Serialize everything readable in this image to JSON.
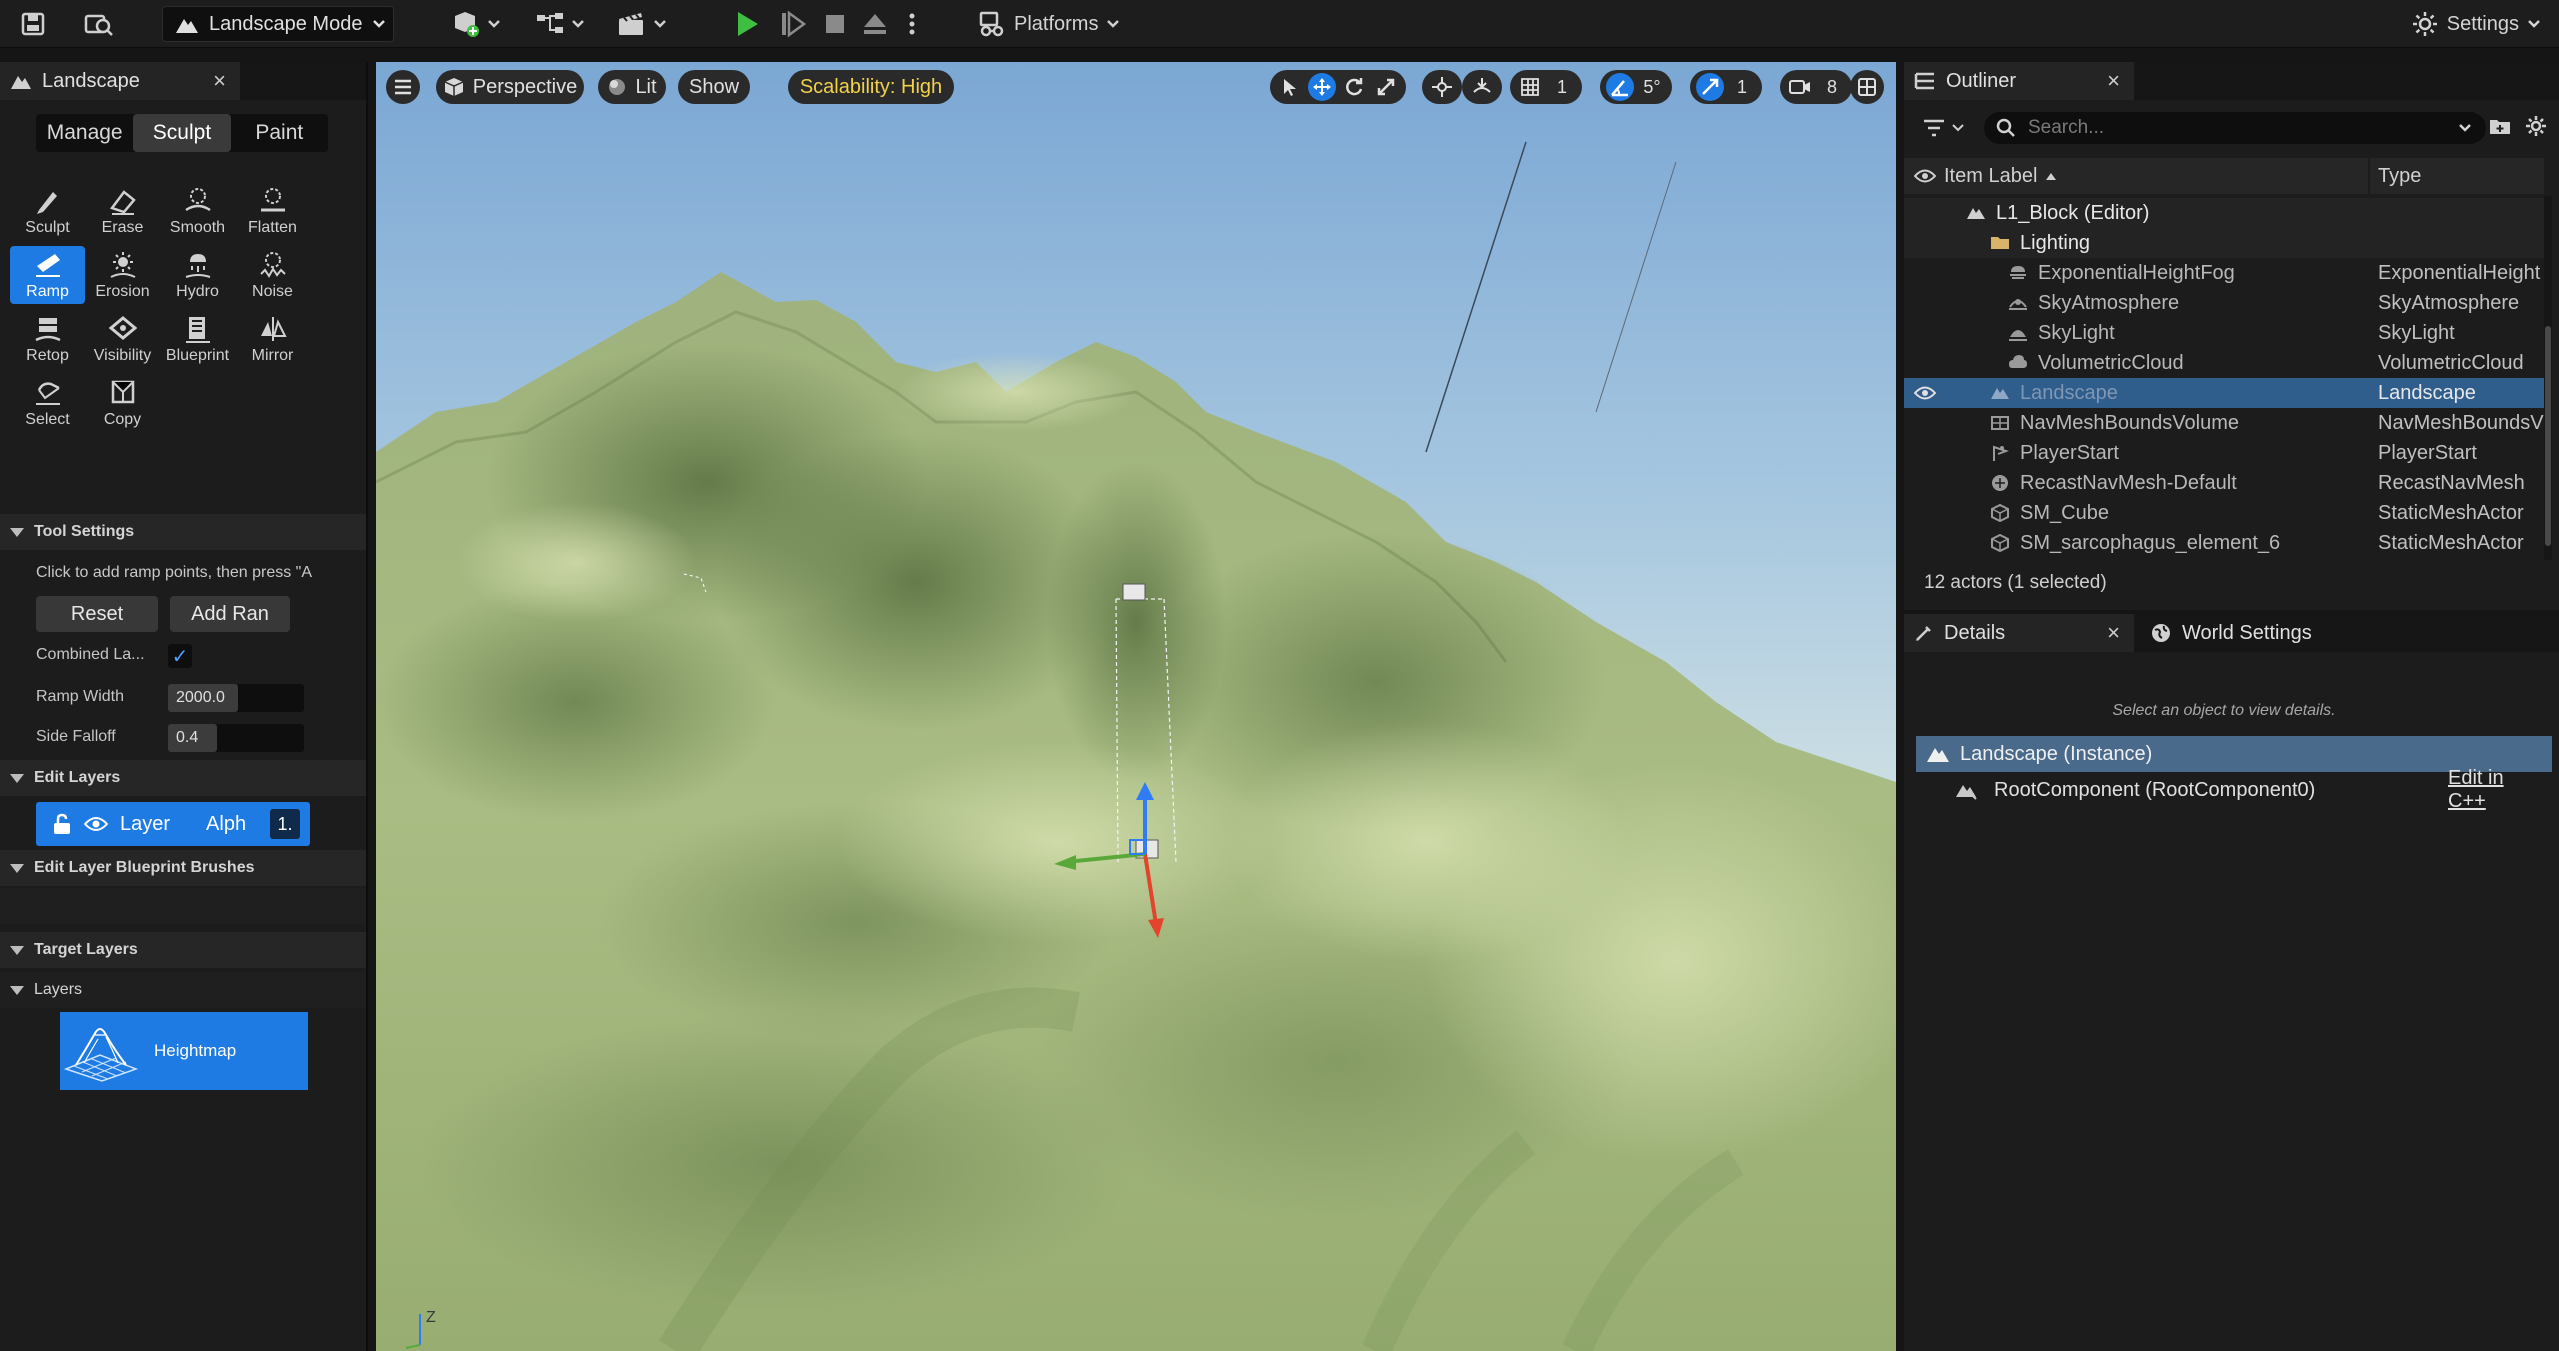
{
  "toolbar": {
    "mode_label": "Landscape Mode",
    "platforms_label": "Platforms",
    "settings_label": "Settings",
    "icons": [
      "save-icon",
      "content-browser-icon",
      "add-actor-icon",
      "blueprint-icon",
      "cinematics-icon",
      "play-icon",
      "step-icon",
      "stop-icon",
      "eject-icon",
      "more-icon",
      "platforms-icon",
      "settings-icon"
    ],
    "play_color": "#3fbf3f"
  },
  "landscape_panel": {
    "tab_title": "Landscape",
    "close_glyph": "×",
    "mode_tabs": [
      "Manage",
      "Sculpt",
      "Paint"
    ],
    "active_mode_tab": "Sculpt",
    "tools": [
      {
        "label": "Sculpt",
        "icon": "sculpt-icon"
      },
      {
        "label": "Erase",
        "icon": "erase-icon"
      },
      {
        "label": "Smooth",
        "icon": "smooth-icon"
      },
      {
        "label": "Flatten",
        "icon": "flatten-icon"
      },
      {
        "label": "Ramp",
        "icon": "ramp-icon"
      },
      {
        "label": "Erosion",
        "icon": "erosion-icon"
      },
      {
        "label": "Hydro",
        "icon": "hydro-icon"
      },
      {
        "label": "Noise",
        "icon": "noise-icon"
      },
      {
        "label": "Retop",
        "icon": "retop-icon"
      },
      {
        "label": "Visibility",
        "icon": "visibility-icon"
      },
      {
        "label": "Blueprint",
        "icon": "blueprint-icon"
      },
      {
        "label": "Mirror",
        "icon": "mirror-icon"
      },
      {
        "label": "Select",
        "icon": "select-icon"
      },
      {
        "label": "Copy",
        "icon": "copy-icon"
      }
    ],
    "active_tool": "Ramp",
    "tool_settings": {
      "header": "Tool Settings",
      "hint": "Click to add ramp points, then press \"A",
      "reset_label": "Reset",
      "add_ramp_label": "Add Ran",
      "combined_label": "Combined La...",
      "combined_checked": true,
      "ramp_width_label": "Ramp Width",
      "ramp_width_value": "2000.0",
      "side_falloff_label": "Side Falloff",
      "side_falloff_value": "0.4",
      "side_falloff_fraction": 0.4
    },
    "edit_layers": {
      "header": "Edit Layers",
      "layer_name": "Layer",
      "alpha_label": "Alph",
      "alpha_value": "1."
    },
    "blueprint_brushes_header": "Edit Layer Blueprint Brushes",
    "target_layers_header": "Target Layers",
    "layers_header": "Layers",
    "heightmap_label": "Heightmap"
  },
  "viewport": {
    "perspective_label": "Perspective",
    "lit_label": "Lit",
    "show_label": "Show",
    "scalability_label": "Scalability: High",
    "scalability_color": "#f2d24a",
    "grid_snap_value": "1",
    "angle_snap_value": "5°",
    "scale_snap_value": "1",
    "camera_speed_value": "8",
    "axis_label": "Z"
  },
  "outliner": {
    "tab_title": "Outliner",
    "close_glyph": "×",
    "search_placeholder": "Search...",
    "col_label": "Item Label",
    "col_type": "Type",
    "rows": [
      {
        "label": "L1_Block (Editor)",
        "type": "",
        "indent": 1,
        "icon": "map-icon"
      },
      {
        "label": "Lighting",
        "type": "",
        "indent": 2,
        "icon": "folder-icon"
      },
      {
        "label": "ExponentialHeightFog",
        "type": "ExponentialHeight",
        "indent": 3,
        "icon": "fog-icon"
      },
      {
        "label": "SkyAtmosphere",
        "type": "SkyAtmosphere",
        "indent": 3,
        "icon": "sky-atmosphere-icon"
      },
      {
        "label": "SkyLight",
        "type": "SkyLight",
        "indent": 3,
        "icon": "skylight-icon"
      },
      {
        "label": "VolumetricCloud",
        "type": "VolumetricCloud",
        "indent": 3,
        "icon": "cloud-icon"
      },
      {
        "label": "Landscape",
        "type": "Landscape",
        "indent": 2,
        "icon": "landscape-icon",
        "selected": true
      },
      {
        "label": "NavMeshBoundsVolume",
        "type": "NavMeshBoundsV",
        "indent": 2,
        "icon": "navmesh-icon"
      },
      {
        "label": "PlayerStart",
        "type": "PlayerStart",
        "indent": 2,
        "icon": "player-start-icon"
      },
      {
        "label": "RecastNavMesh-Default",
        "type": "RecastNavMesh",
        "indent": 2,
        "icon": "recast-icon"
      },
      {
        "label": "SM_Cube",
        "type": "StaticMeshActor",
        "indent": 2,
        "icon": "static-mesh-icon"
      },
      {
        "label": "SM_sarcophagus_element_6",
        "type": "StaticMeshActor",
        "indent": 2,
        "icon": "static-mesh-icon"
      }
    ],
    "status": "12 actors (1 selected)"
  },
  "details": {
    "tab_title": "Details",
    "close_glyph": "×",
    "world_settings_label": "World Settings",
    "message": "Select an object to view details.",
    "instance_label": "Landscape (Instance)",
    "root_label": "RootComponent (RootComponent0)",
    "edit_cpp_label": "Edit in C++"
  }
}
